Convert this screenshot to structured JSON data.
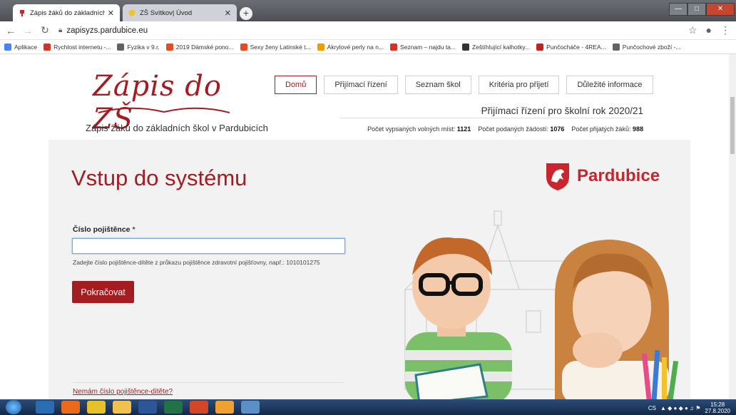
{
  "browser": {
    "tabs": [
      {
        "title": "Zápis žáků do základních škol v P",
        "active": true
      },
      {
        "title": "ZŠ Svítkov| Úvod",
        "active": false
      }
    ],
    "url": "zapisyzs.pardubice.eu",
    "bookmarks": [
      {
        "label": "Aplikace",
        "color": "#4285f4"
      },
      {
        "label": "Rychlost internetu -...",
        "color": "#d93025"
      },
      {
        "label": "Fyzika v 9.r.",
        "color": "#5f6368"
      },
      {
        "label": "2019 Dámské pono...",
        "color": "#e8491d"
      },
      {
        "label": "Sexy ženy Latinské t...",
        "color": "#e8491d"
      },
      {
        "label": "Akrylové perly na n...",
        "color": "#f29900"
      },
      {
        "label": "Seznam – najdu ta...",
        "color": "#d93025"
      },
      {
        "label": "Zeštíhlující kalhotky...",
        "color": "#333333"
      },
      {
        "label": "Punčocháče - 4REA...",
        "color": "#c5221f"
      },
      {
        "label": "Punčochové zboží -...",
        "color": "#5f6368"
      }
    ]
  },
  "header": {
    "logo_text": "Zápis do ZŠ",
    "subtitle": "Zápis žáků do základních škol v Pardubicích",
    "menu": [
      "Domů",
      "Přijímací řízení",
      "Seznam škol",
      "Kritéria pro přijetí",
      "Důležité informace"
    ],
    "active_menu": "Domů",
    "year_text": "Přijímací řízení pro školní rok 2020/21",
    "stats": [
      {
        "label": "Počet vypsaných volných míst:",
        "value": "1121"
      },
      {
        "label": "Počet podaných žádostí:",
        "value": "1076"
      },
      {
        "label": "Počet přijatých žáků:",
        "value": "988"
      }
    ]
  },
  "login": {
    "title": "Vstup do systému",
    "field_label": "Číslo pojištěnce",
    "required_mark": "*",
    "field_value": "",
    "hint": "Zadejte číslo pojištěnce-dítěte z průkazu pojištěnce zdravotní pojišťovny, např.: 1010101275",
    "submit_label": "Pokračovat",
    "no_number_link": "Nemám číslo pojištěnce-dítěte?"
  },
  "brand": {
    "name": "Pardubice",
    "color": "#c8252c"
  },
  "taskbar": {
    "lang": "CS",
    "time": "15:28",
    "date": "27.8.2020"
  },
  "colors": {
    "accent": "#a31c22",
    "panel": "#f2f2f2"
  }
}
